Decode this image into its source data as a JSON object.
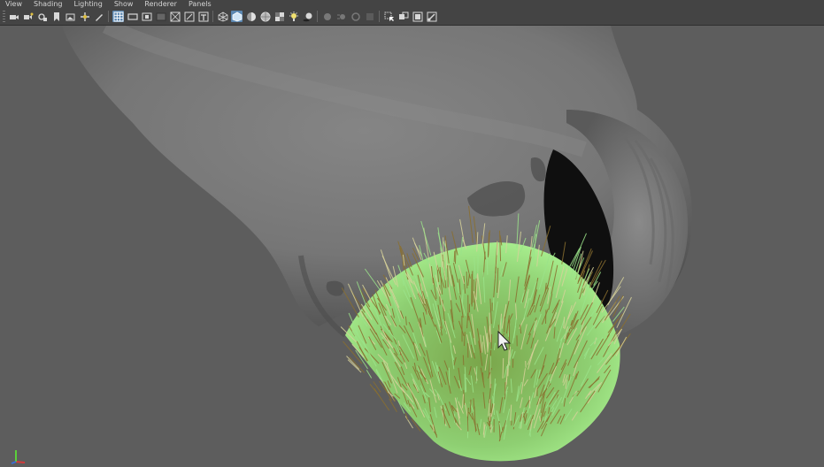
{
  "panel_menu": {
    "items": [
      {
        "label": "View"
      },
      {
        "label": "Shading"
      },
      {
        "label": "Lighting"
      },
      {
        "label": "Show"
      },
      {
        "label": "Renderer"
      },
      {
        "label": "Panels"
      }
    ]
  },
  "toolbar": {
    "groups": [
      [
        "camera-icon",
        "camera-attributes-icon",
        "camera-lock-icon",
        "bookmark-icon",
        "image-plane-icon",
        "two-d-pan-zoom-icon",
        "grease-pencil-icon"
      ],
      [
        "grid-icon",
        "film-gate-icon",
        "resolution-gate-icon",
        "gate-mask-icon",
        "field-chart-icon",
        "safe-action-icon",
        "safe-title-icon"
      ],
      [
        "wireframe-icon",
        "smooth-shade-icon",
        "default-material-icon",
        "wireframe-on-shaded-icon",
        "textured-icon",
        "use-all-lights-icon",
        "shadows-icon"
      ],
      [
        "screen-space-ao-icon",
        "motion-blur-icon",
        "multisample-aa-icon",
        "depth-of-field-icon"
      ],
      [
        "isolate-select-icon",
        "xray-icon",
        "xray-active-components-icon",
        "xray-joints-icon"
      ]
    ],
    "active": [
      "grid-icon",
      "smooth-shade-icon"
    ],
    "disabled": [
      "screen-space-ao-icon",
      "motion-blur-icon",
      "multisample-aa-icon",
      "depth-of-field-icon"
    ]
  },
  "viewport": {
    "background_color": "#5d5d5d",
    "mesh_color": "#7c7c7c",
    "hair_tip_color": "#9be38a",
    "hair_root_color": "#8a6f2f",
    "axis_colors": {
      "x": "#d63a3a",
      "y": "#5bcf3a",
      "z": "#3a6fd6"
    }
  }
}
